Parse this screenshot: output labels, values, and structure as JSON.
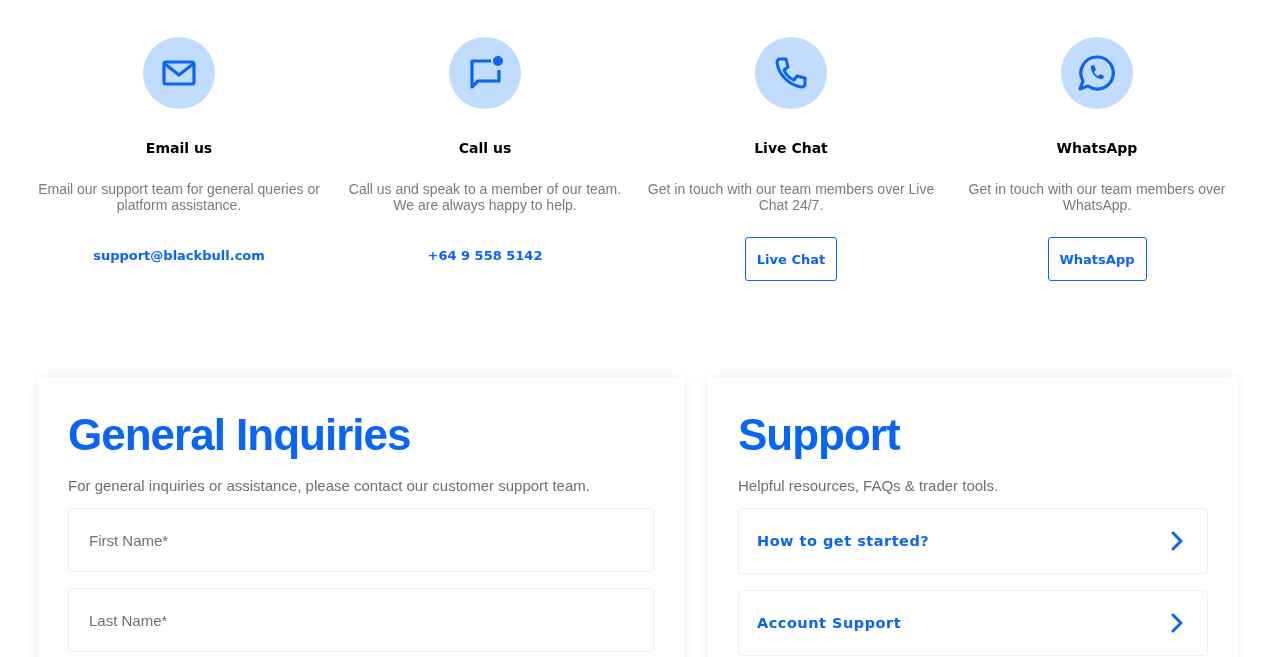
{
  "contact_methods": [
    {
      "title": "Email us",
      "description": "Email our support team for general queries or platform assistance.",
      "action": {
        "kind": "link",
        "label": "support@blackbull.com"
      }
    },
    {
      "title": "Call us",
      "description": "Call us and speak to a member of our team. We are always happy to help.",
      "action": {
        "kind": "link",
        "label": "+64 9 558 5142"
      }
    },
    {
      "title": "Live Chat",
      "description": "Get in touch with our team members over Live Chat 24/7.",
      "action": {
        "kind": "button",
        "label": "Live Chat"
      }
    },
    {
      "title": "WhatsApp",
      "description": "Get in touch with our team members over WhatsApp.",
      "action": {
        "kind": "button",
        "label": "WhatsApp"
      }
    }
  ],
  "general_inquiries": {
    "title": "General Inquiries",
    "subtitle": "For general inquiries or assistance, please contact our customer support team.",
    "fields": [
      {
        "placeholder": "First Name*"
      },
      {
        "placeholder": "Last Name*"
      }
    ]
  },
  "support": {
    "title": "Support",
    "subtitle": "Helpful resources, FAQs & trader tools.",
    "links": [
      {
        "label": "How to get started?"
      },
      {
        "label": "Account Support"
      }
    ]
  }
}
